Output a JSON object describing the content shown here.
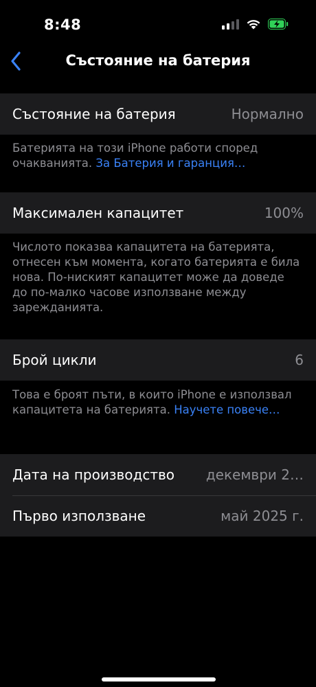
{
  "status_bar": {
    "time": "8:48",
    "signal_icon": "cellular-signal-icon",
    "wifi_icon": "wifi-icon",
    "battery_icon": "battery-charging-icon",
    "battery_color": "#30d158"
  },
  "nav": {
    "back_icon": "chevron-left-icon",
    "title": "Състояние на батерия",
    "accent": "#3a82f7"
  },
  "battery_health": {
    "label": "Състояние на батерия",
    "value": "Нормално",
    "footnote_text": "Батерията на този iPhone работи според очакванията. ",
    "footnote_link": "За Батерия и гаранция…"
  },
  "max_capacity": {
    "label": "Максимален капацитет",
    "value": "100%",
    "footnote_text": "Числото показва капацитета на батерията, отнесен към момента, когато батерията е била нова. По-ниският капацитет може да доведе до по-малко часове използване между зарежданията."
  },
  "cycle_count": {
    "label": "Брой цикли",
    "value": "6",
    "footnote_text": "Това е броят пъти, в които iPhone е използвал капацитета на батерията. ",
    "footnote_link": "Научете повече…"
  },
  "dates": {
    "manufacture_label": "Дата на производство",
    "manufacture_value": "декември 2…",
    "first_use_label": "Първо използване",
    "first_use_value": "май 2025 г."
  }
}
